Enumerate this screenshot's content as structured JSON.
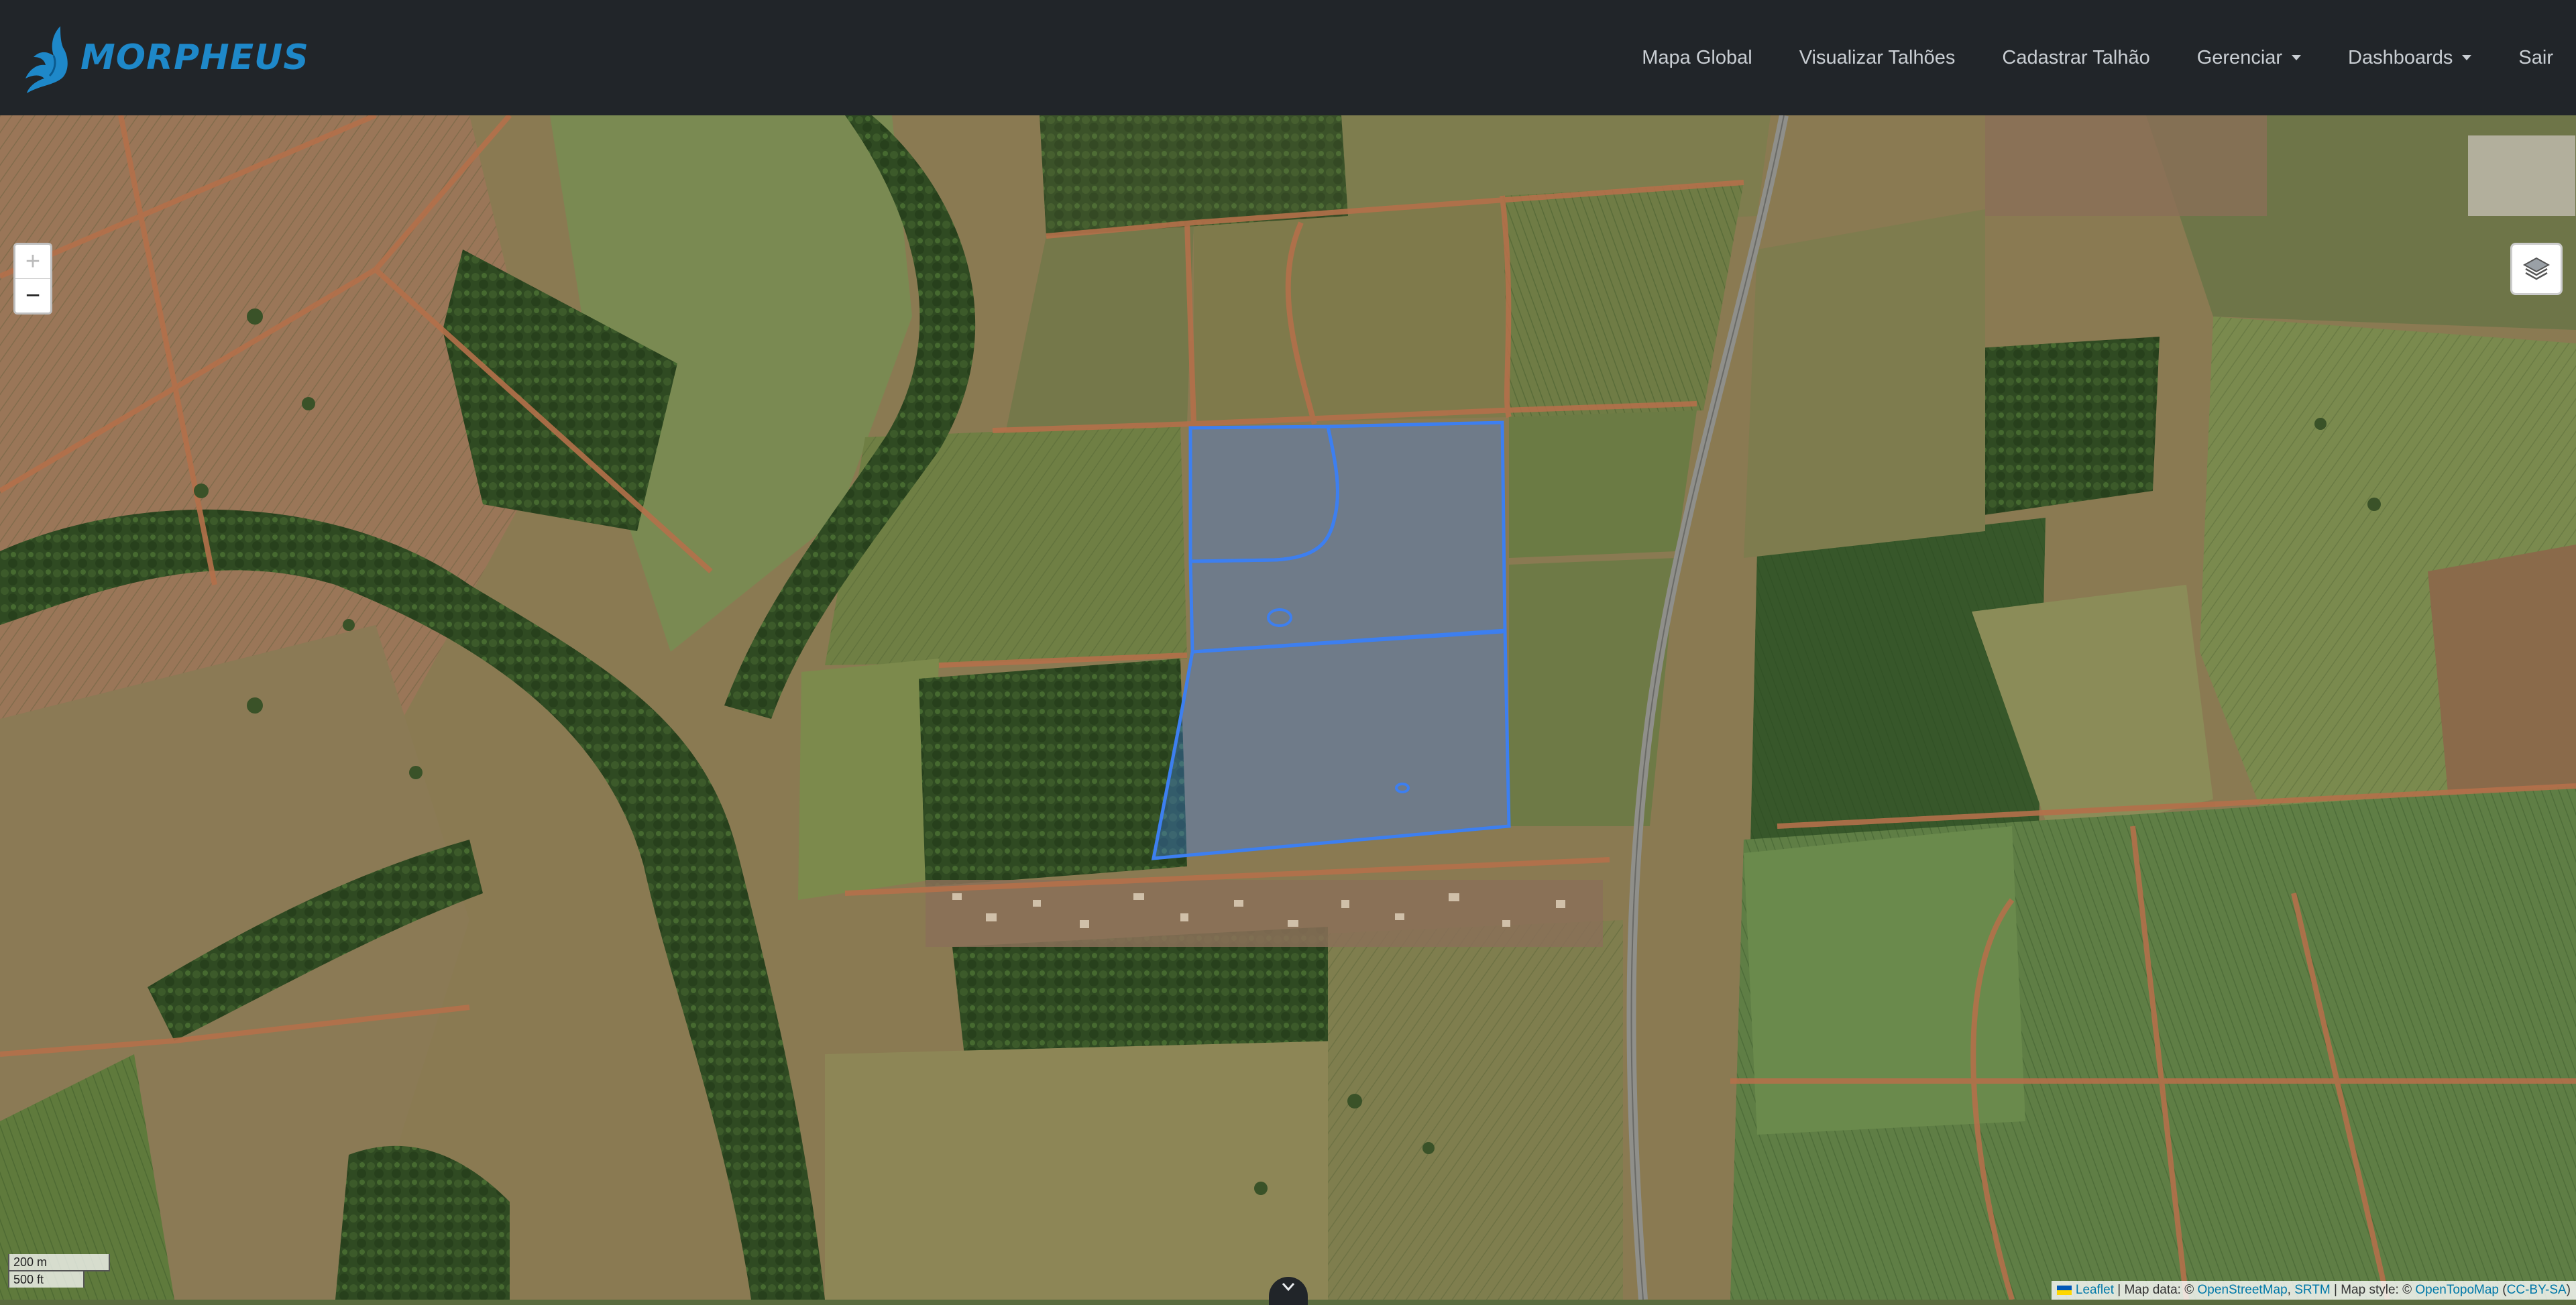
{
  "brand": {
    "name": "MORPHEUS"
  },
  "nav": {
    "items": [
      {
        "label": "Mapa Global",
        "dropdown": false
      },
      {
        "label": "Visualizar Talhões",
        "dropdown": false
      },
      {
        "label": "Cadastrar Talhão",
        "dropdown": false
      },
      {
        "label": "Gerenciar",
        "dropdown": true
      },
      {
        "label": "Dashboards",
        "dropdown": true
      },
      {
        "label": "Sair",
        "dropdown": false
      }
    ]
  },
  "map": {
    "zoom_in": "+",
    "zoom_out": "−",
    "scale_metric": "200 m",
    "scale_imperial": "500 ft",
    "attribution": {
      "leaflet": "Leaflet",
      "map_data_prefix": "| Map data: ©",
      "osm": "OpenStreetMap",
      "srtm": "SRTM",
      "style_prefix": "| Map style: ©",
      "opentopomap": "OpenTopoMap",
      "license": "CC-BY-SA"
    },
    "polygon_color": "#3d7ff0"
  }
}
